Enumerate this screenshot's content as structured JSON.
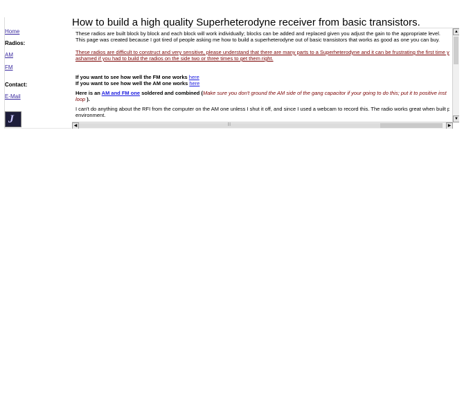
{
  "sidebar": {
    "home": "Home",
    "radios_header": "Radios:",
    "am": "AM",
    "fm": "FM",
    "contact_header": "Contact:",
    "email": "E-Mail",
    "logo_glyph": "J"
  },
  "title": "How to build a high quality Superheterodyne receiver from basic transistors.",
  "content": {
    "para1_line1": "These radios are built block by block and each block will work individually; blocks can be added and replaced given you adjust the gain to the appropriate level.",
    "para1_line2": "This page was created because I got tired of people asking me how to build a superheterodyne out of basic transistors that works as good as one you can buy.",
    "warn_line1": "These radios are difficult to construct and very sensitive, please understand that there are many parts to a Superheterodyne and it can be frustrating the first time you",
    "warn_line2": "ashamed if you had to build the radios on the side two or three times to get them right.",
    "fm_works": "If you want to see how well the FM one works",
    "am_works": "If you want to see how well the AM one works",
    "here": "here",
    "combined_pre": "Here is an",
    "combined_link": "AM and FM one",
    "combined_mid": "soldered and combined (",
    "combined_ital1": "Make sure you don't ground the AM side of the gang capacitor if your going to do this; put it to positive inst",
    "combined_ital2": "loop",
    "combined_end": ").",
    "rfi_line1": "I can't do anything about the RFI from the computer on the AM one unless I shut it off, and since I used a webcam to record this.  The radio works great when built pro",
    "rfi_line2": "environment."
  },
  "scroll": {
    "up": "▲",
    "down": "▼",
    "left": "◀",
    "right": "▶",
    "grip": "|||"
  }
}
